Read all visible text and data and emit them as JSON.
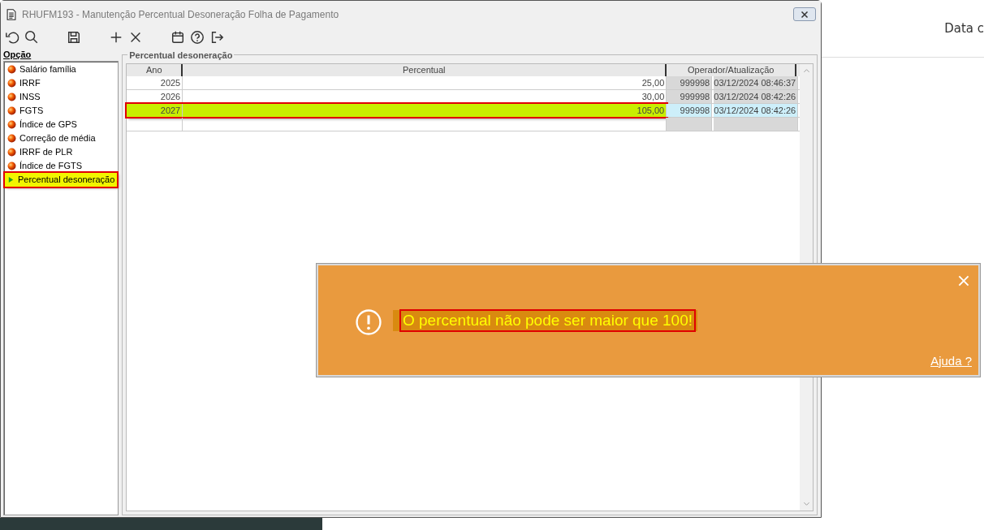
{
  "background_page": {
    "header_text": "Data c"
  },
  "window": {
    "title": "RHUFM193 - Manutenção Percentual Desoneração Folha de Pagamento"
  },
  "sidebar": {
    "label": "Opção",
    "items": [
      {
        "label": "Salário família",
        "selected": false
      },
      {
        "label": "IRRF",
        "selected": false
      },
      {
        "label": "INSS",
        "selected": false
      },
      {
        "label": "FGTS",
        "selected": false
      },
      {
        "label": "Índice de GPS",
        "selected": false
      },
      {
        "label": "Correção de média",
        "selected": false
      },
      {
        "label": "IRRF de PLR",
        "selected": false
      },
      {
        "label": "Índice de FGTS",
        "selected": false
      },
      {
        "label": "Percentual desoneração",
        "selected": true
      }
    ]
  },
  "group": {
    "title": "Percentual desoneração"
  },
  "table": {
    "columns": [
      "Ano",
      "Percentual",
      "Operador/Atualização"
    ],
    "rows": [
      {
        "ano": "2025",
        "percentual": "25,00",
        "operador": "999998",
        "atualizacao": "03/12/2024 08:46:37",
        "selected": false
      },
      {
        "ano": "2026",
        "percentual": "30,00",
        "operador": "999998",
        "atualizacao": "03/12/2024 08:42:26",
        "selected": false
      },
      {
        "ano": "2027",
        "percentual": "105,00",
        "operador": "999998",
        "atualizacao": "03/12/2024 08:42:26",
        "selected": true
      }
    ]
  },
  "alert": {
    "message": "O percentual não pode ser maior que 100!",
    "help_link": "Ajuda ?"
  }
}
